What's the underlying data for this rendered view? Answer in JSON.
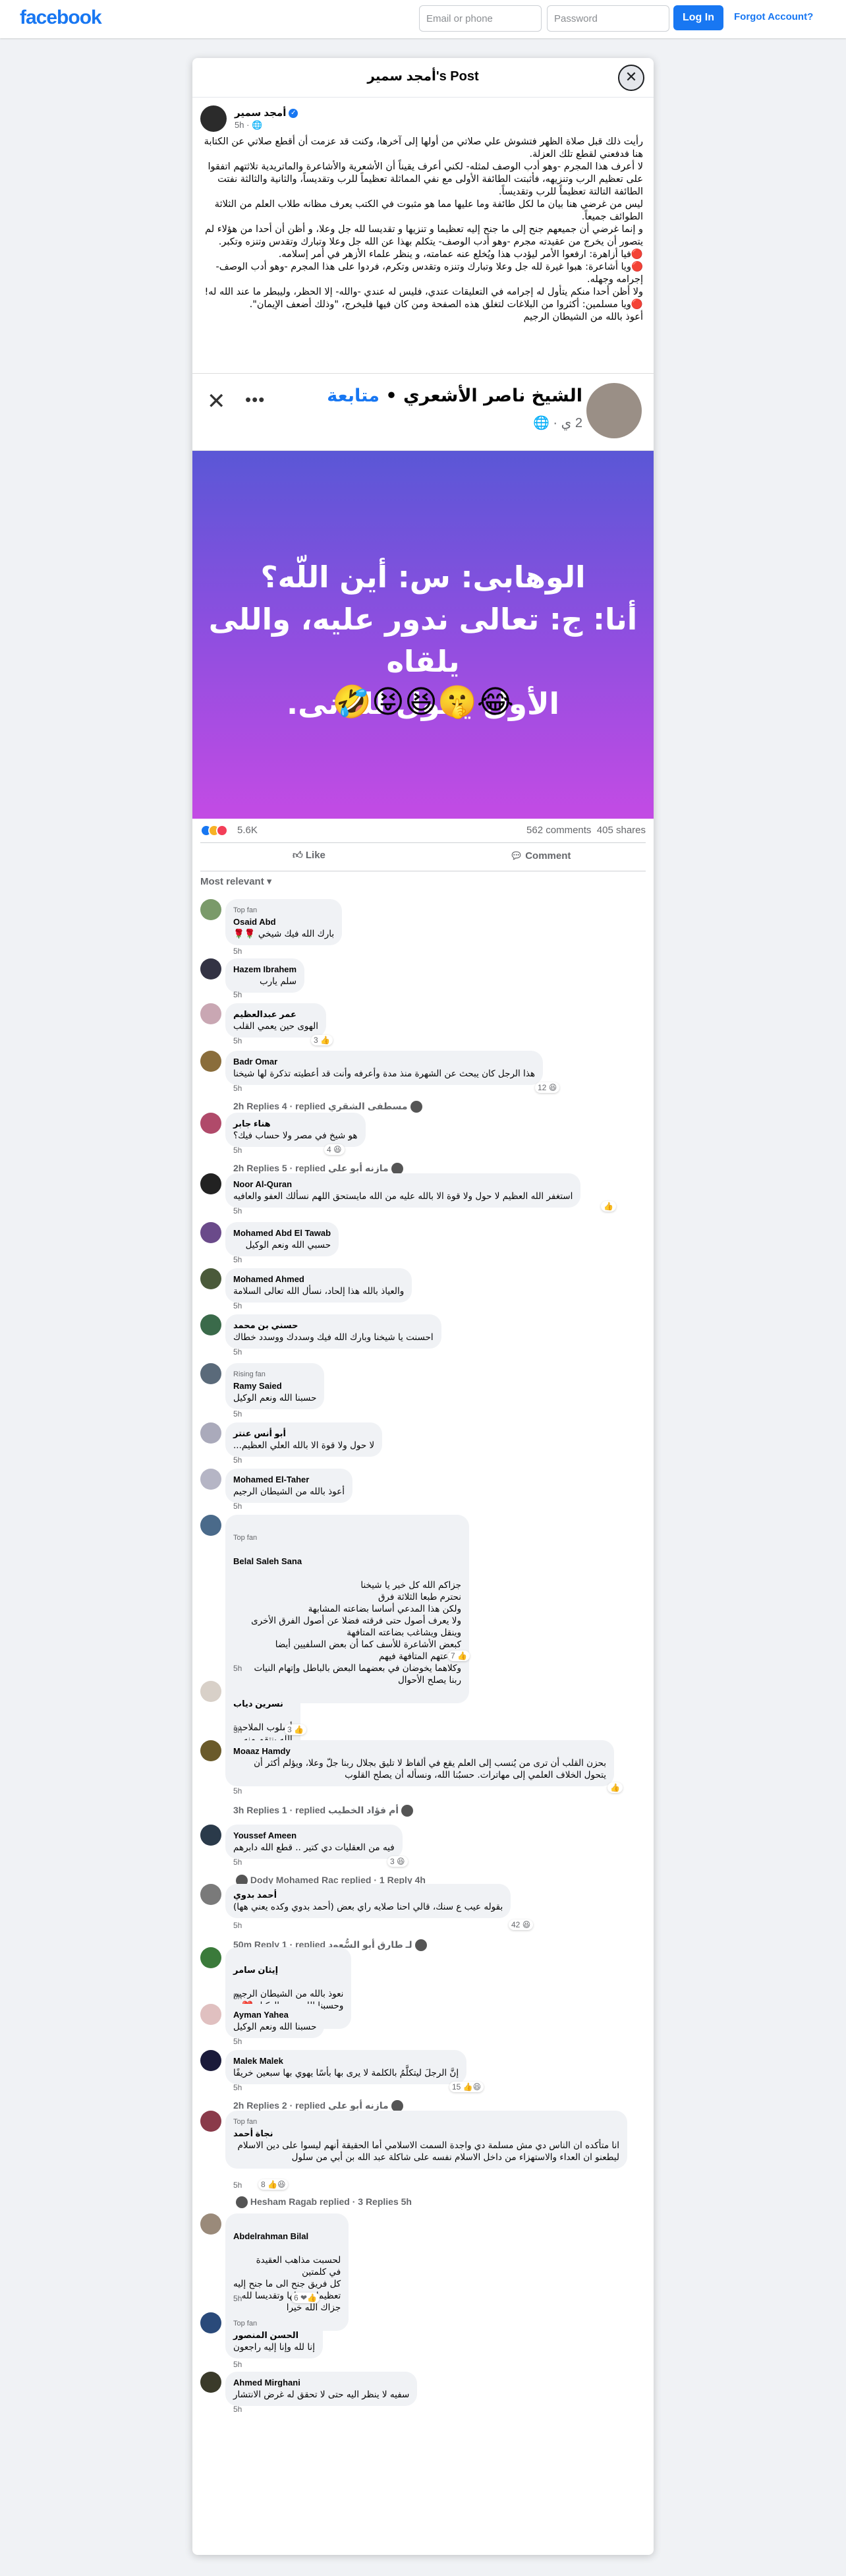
{
  "topbar": {
    "logo": "facebook",
    "email_placeholder": "Email or phone",
    "password_placeholder": "Password",
    "login_label": "Log In",
    "forgot_label": "Forgot Account?"
  },
  "dialog": {
    "title": "أمجد سمير's Post",
    "close_icon": "close-icon"
  },
  "post": {
    "author": "أمجد سمير",
    "time": "5h",
    "privacy_icon": "globe-icon",
    "paragraphs": [
      "رأيت ذلك قبل صلاة الظهر فتشوش علي صلاتي من أولها إلى آخرها، وكنت قد عزمت أن أقطع صلاتي عن الكتابة هنا فدفعني لقطع تلك العزلة.",
      "لا أعرف هذا المجرم -وهو أدب الوصف لمثله- لكني أعرف يقيناً أن الأشعرية والأشاعرة والماتريدية تلاثتهم اتفقوا على تعظيم الرب وتنزيهه، فأثبتت الطائفة الأولى مع نفي المماثلة تعظيماً للرب وتقديساً، والثانية والثالثة نفتت الطائفة التالتة تعظيماً للرب وتقديساً.",
      "ليس من غرضي هنا بيان ما لكل طائفة وما عليها مما هو مثبوت في الكتب يعرف مظانه طلاب العلم من الثلاثة الطوائف جميعاً.",
      "و إنما غرضي أن جميعهم جنح إلى ما جنح إليه تعظيما و تنزيها و تقديسا لله جل وعلا، و أظن أن أحدا من هؤلاء لم يتصور أن يخرج من عقيدته مجرم -وهو أدب الوصف- يتكلم بهذا عن الله جل وعلا وتبارك وتقدس وتنزه وتكبر.",
      "🔴فيا أزاهرة: ارفعوا الأمر ليؤدب هذا ويُخلع عنه عمامته، و ينظر علماء الأزهر في أمر إسلامه.",
      "🔴ويا أشاعرة: هبوا غيرة لله جل وعلا وتبارك وتنزه وتقدس وتكرم، فردوا على هذا المجرم -وهو أدب الوصف- إجرامه وجهله.",
      "ولا أظن أحدا منكم يتأول له إجرامه في التعليقات عندي، فليس له عندي -والله- إلا الحظر، وليبطر ما عند الله له!",
      "🔴ويا مسلمين: أكثروا من البلاغات لتغلق هذه الصفحة ومن كان فيها فليخرج، \"وذلك أضعف الإيمان\".",
      "أعوذ بالله من الشيطان الرجيم"
    ]
  },
  "shared": {
    "name": "الشيخ ناصر الأشعري",
    "follow": "متابعة",
    "meta": "2 ي",
    "caption_line1": "الوهابى: س: أين اللّه؟",
    "caption_line2": "أنا: ج: تعالى ندور عليه، واللى يلقاه",
    "caption_line3": "الأول يقول للتانى.",
    "emoji": "🤣😝😆🤫😂"
  },
  "stats": {
    "reactions": "5.6K",
    "comments": "562 comments",
    "shares": "405 shares"
  },
  "actions": {
    "like": "Like",
    "comment": "Comment"
  },
  "sort_label": "Most relevant",
  "comments": [
    {
      "badge": "Top fan",
      "name": "Osaid Abd",
      "text": "بارك الله فيك شيخي 🌹🌹",
      "time": "5h"
    },
    {
      "name": "Hazem Ibrahem",
      "text": "سلم يارب",
      "time": "5h"
    },
    {
      "name": "عمر عبدالعظيم",
      "text": "الهوى حين يعمي القلب",
      "time": "5h",
      "reacts": "3"
    },
    {
      "name": "Badr Omar",
      "text": "هذا الرجل كان يبحث عن الشهرة منذ مدة وأعرفه وأنت قد أعطيته تذكرة لها شيخنا",
      "time": "5h",
      "reacts": "12",
      "replies": "2h Replies 4 · replied مسطفى الشقري"
    },
    {
      "name": "هناء جابر",
      "text": "هو شيخ في مصر ولا حساب فيك؟",
      "time": "5h",
      "reacts": "4",
      "replies": "2h Replies 5 · replied مازنه أبو علي"
    },
    {
      "name": "Noor Al-Quran",
      "text": "استغفر الله العظيم لا حول ولا قوة الا بالله عليه من الله مايستحق اللهم نسألك العفو والعافيه",
      "time": "5h"
    },
    {
      "name": "Mohamed Abd El Tawab",
      "text": "حسبي الله ونعم الوكيل",
      "time": "5h"
    },
    {
      "name": "Mohamed Ahmed",
      "text": "والعياذ بالله هذا إلحاد، نسأل الله تعالى السلامة",
      "time": "5h"
    },
    {
      "name": "حسني بن محمد",
      "text": "احسنت يا شيخنا وبارك الله فيك وسددك ووسدد خطاك",
      "time": "5h"
    },
    {
      "badge": "Rising fan",
      "name": "Ramy Saied",
      "text": "حسبنا الله ونعم الوكيل",
      "time": "5h"
    },
    {
      "name": "أبو أنس عنتر",
      "text": "لا حول ولا قوة الا بالله العلي العظيم...",
      "time": "5h"
    },
    {
      "name": "Mohamed El-Taher",
      "text": "أعوذ بالله من الشيطان الرجيم",
      "time": "5h"
    },
    {
      "badge": "Top fan",
      "name": "Belal Saleh Sana",
      "text": "جزاكم الله كل خير يا شيخنا\nنحترم طبعا الثلاثة فرق\nولكن هذا المدعي أساسا بضاعته المشابهة\nولا يعرف أصول حتى فرقته فضلا عن أصول الفرق الأخرى\nوينقل ويشاغب بضاعته المتافهة\nكبعض الأشاعرة للأسف كما أن بعض السلفيين أيضا\nبضاعتهم المتافهة فيهم\nوكلاهما يخوضان في بعضهما البعض بالباطل وإتهام النيات\nربنا يصلح الأحوال",
      "time": "5h",
      "reacts": "7"
    },
    {
      "name": "نسرين دياب",
      "text": "أسلوب الملاحدة\nالله ينتقم منه",
      "time": "5h",
      "reacts": "3"
    },
    {
      "name": "Moaaz Hamdy",
      "text": "بحزن القلب أن ترى من يُنسب إلى العلم يقع في ألفاظ لا تليق بجلال ربنا جلّ وعلا، ويؤلم أكثر أن يتحول الخلاف العلمي إلى مهاترات. حسبُنا الله، ونسأله أن يصلح القلوب",
      "time": "5h",
      "replies": "3h Replies 1 · replied أم فؤاد الخطيب"
    },
    {
      "name": "Youssef Ameen",
      "text": "فيه من العقليات دي كتير .. قطع الله دابرهم",
      "time": "5h",
      "reacts": "3",
      "replies": "Dody Mohamed Rac replied · 1 Reply 4h"
    },
    {
      "name": "أحمد بدوي",
      "text": "بقوله عيب ع سنك، قالي احنا صلايه راي بعض (أحمد بدوي وكده يعني هها)",
      "time": "5h",
      "reacts": "42",
      "replies": "50m Reply 1 · replied لـ طارق أبو السُّعود"
    },
    {
      "name": "إيثان سامر",
      "text": "نعوذ بالله من الشيطان الرجيم\nوحسبنا الله ونعم الوكيل ❤️",
      "time": "5h"
    },
    {
      "name": "Ayman Yahea",
      "text": "حسبنا الله ونعم الوكيل",
      "time": "5h"
    },
    {
      "name": "Malek Malek",
      "text": "إنَّ الرجلَ ليتكلَّمُ بالكلمة لا يرى بها بأسًا يهوي بها سبعين خريفًا",
      "time": "5h",
      "reacts": "15",
      "replies": "2h Replies 2 · replied مازنه أبو علي"
    },
    {
      "badge": "Top fan",
      "name": "نجاة أحمد",
      "text": "انا متأكده ان الناس دي مش مسلمة دي واجدة السمت الاسلامي أما الحقيقة أنهم ليسوا على دين الاسلام ليطعنو ان العداء والاستهزاء من داخل الاسلام نفسه على شاكلة عبد الله بن أبي من سلول",
      "time": "5h",
      "reacts": "8",
      "replies": "Hesham Ragab replied · 3 Replies 5h"
    },
    {
      "name": "Abdelrahman Bilal",
      "text": "لحسبت مذاهب العقيدة\nفي كلمتين\nكل فريق جنح الى ما جنح إليه\nتعظيما وتنزيلها وتقديسا لله\nجزاك الله خيرا",
      "time": "5h",
      "reacts": "6"
    },
    {
      "badge": "Top fan",
      "name": "الحسن المنصور",
      "text": "إنا لله وإنا إليه راجعون",
      "time": "5h"
    },
    {
      "name": "Ahmed Mirghani",
      "text": "سفيه لا ينظر اليه حتى لا تحقق له غرض الانتشار",
      "time": "5h"
    }
  ]
}
